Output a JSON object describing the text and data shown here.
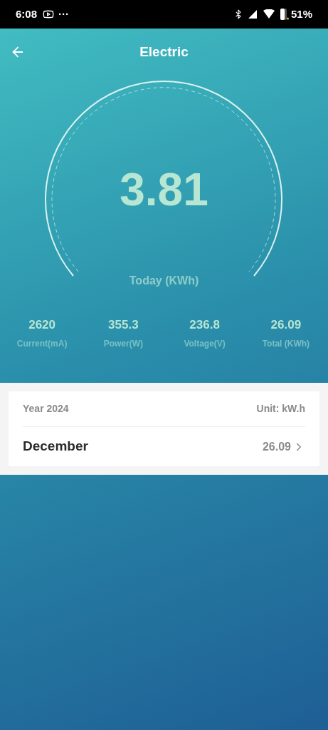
{
  "status_bar": {
    "time": "6:08",
    "more": "···",
    "battery": "51%"
  },
  "header": {
    "title": "Electric"
  },
  "gauge": {
    "value": "3.81",
    "label": "Today (KWh)"
  },
  "stats": [
    {
      "value": "2620",
      "label": "Current(mA)"
    },
    {
      "value": "355.3",
      "label": "Power(W)"
    },
    {
      "value": "236.8",
      "label": "Voltage(V)"
    },
    {
      "value": "26.09",
      "label": "Total (KWh)"
    }
  ],
  "card": {
    "year": "Year 2024",
    "unit": "Unit: kW.h",
    "rows": [
      {
        "month": "December",
        "value": "26.09"
      }
    ]
  }
}
